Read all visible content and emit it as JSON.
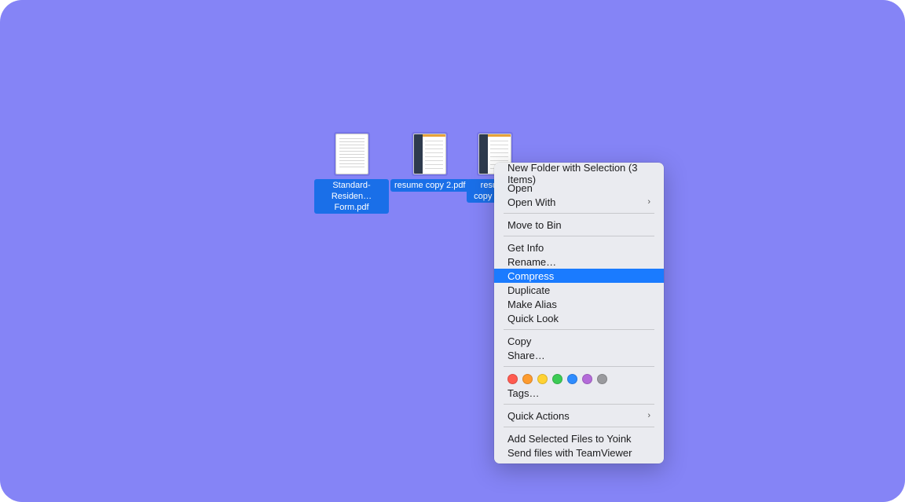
{
  "files": [
    {
      "label": "Standard-Residen…Form.pdf"
    },
    {
      "label": "resume copy 2.pdf"
    },
    {
      "label": "resume copy 2.png"
    }
  ],
  "menu": {
    "items": {
      "new_folder": "New Folder with Selection (3 Items)",
      "open": "Open",
      "open_with": "Open With",
      "move_bin": "Move to Bin",
      "get_info": "Get Info",
      "rename": "Rename…",
      "compress": "Compress",
      "duplicate": "Duplicate",
      "make_alias": "Make Alias",
      "quick_look": "Quick Look",
      "copy": "Copy",
      "share": "Share…",
      "tags": "Tags…",
      "quick_actions": "Quick Actions",
      "yoink": "Add Selected Files to Yoink",
      "teamviewer": "Send files with TeamViewer"
    }
  },
  "tag_colors": [
    "#ff5b50",
    "#fd9b2f",
    "#ffd233",
    "#3ccb55",
    "#2e8cff",
    "#b46bd9",
    "#9a9a9e"
  ]
}
